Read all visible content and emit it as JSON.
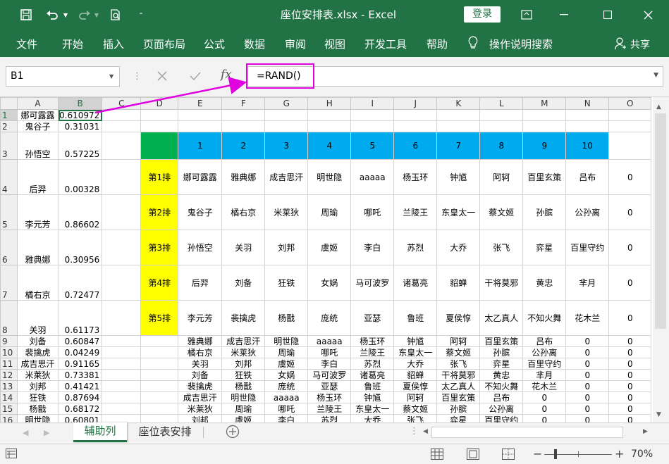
{
  "window": {
    "title": "座位安排表.xlsx  -  Excel",
    "login": "登录"
  },
  "ribbon": {
    "tabs": [
      "文件",
      "开始",
      "插入",
      "页面布局",
      "公式",
      "数据",
      "审阅",
      "视图",
      "开发工具",
      "帮助",
      "操作说明搜索"
    ],
    "share": "共享"
  },
  "formula_bar": {
    "cell": "B1",
    "formula": "=RAND()"
  },
  "columns": [
    "A",
    "B",
    "C",
    "D",
    "E",
    "F",
    "G",
    "H",
    "I",
    "J",
    "K",
    "L",
    "M",
    "N",
    "O"
  ],
  "numbers": [
    "1",
    "2",
    "3",
    "4",
    "5",
    "6",
    "7",
    "8",
    "9",
    "10"
  ],
  "rows": [
    {
      "num": "1",
      "a": "娜可露露",
      "b": "0.610972"
    },
    {
      "num": "2",
      "a": "鬼谷子",
      "b": "0.31031"
    },
    {
      "num": "3",
      "a": "孙悟空",
      "b": "0.57225"
    },
    {
      "num": "4",
      "a": "后羿",
      "b": "0.00328",
      "d": "第1排",
      "e": [
        "娜可露露",
        "雅典娜",
        "成吉思汗",
        "明世隐",
        "aaaaa",
        "杨玉环",
        "钟馗",
        "阿轲",
        "百里玄策",
        "吕布"
      ],
      "o": "0"
    },
    {
      "num": "5",
      "a": "李元芳",
      "b": "0.86602",
      "d": "第2排",
      "e": [
        "鬼谷子",
        "橘右京",
        "米莱狄",
        "周瑜",
        "哪吒",
        "兰陵王",
        "东皇太一",
        "蔡文姬",
        "孙膑",
        "公孙离"
      ],
      "o": "0"
    },
    {
      "num": "6",
      "a": "雅典娜",
      "b": "0.30956",
      "d": "第3排",
      "e": [
        "孙悟空",
        "关羽",
        "刘邦",
        "虞姬",
        "李白",
        "苏烈",
        "大乔",
        "张飞",
        "弈星",
        "百里守约"
      ],
      "o": "0"
    },
    {
      "num": "7",
      "a": "橘右京",
      "b": "0.72477",
      "d": "第4排",
      "e": [
        "后羿",
        "刘备",
        "狂铁",
        "女娲",
        "马可波罗",
        "诸葛亮",
        "貂蝉",
        "干将莫邪",
        "黄忠",
        "芈月"
      ],
      "o": "0"
    },
    {
      "num": "8",
      "a": "关羽",
      "b": "0.61173",
      "d": "第5排",
      "e": [
        "李元芳",
        "裴擒虎",
        "杨戬",
        "庞统",
        "亚瑟",
        "鲁班",
        "夏侯惇",
        "太乙真人",
        "不知火舞",
        "花木兰"
      ],
      "o": "0"
    },
    {
      "num": "9",
      "a": "刘备",
      "b": "0.60847",
      "e": [
        "雅典娜",
        "成吉思汗",
        "明世隐",
        "aaaaa",
        "杨玉环",
        "钟馗",
        "阿轲",
        "百里玄策",
        "吕布",
        "0",
        "0"
      ]
    },
    {
      "num": "10",
      "a": "裴擒虎",
      "b": "0.04249",
      "e": [
        "橘右京",
        "米莱狄",
        "周瑜",
        "哪吒",
        "兰陵王",
        "东皇太一",
        "蔡文姬",
        "孙膑",
        "公孙离",
        "0",
        "0"
      ]
    },
    {
      "num": "11",
      "a": "成吉思汗",
      "b": "0.91165",
      "e": [
        "关羽",
        "刘邦",
        "虞姬",
        "李白",
        "苏烈",
        "大乔",
        "张飞",
        "弈星",
        "百里守约",
        "0",
        "0"
      ]
    },
    {
      "num": "12",
      "a": "米莱狄",
      "b": "0.73381",
      "e": [
        "刘备",
        "狂铁",
        "女娲",
        "马可波罗",
        "诸葛亮",
        "貂蝉",
        "干将莫邪",
        "黄忠",
        "芈月",
        "0",
        "0"
      ]
    },
    {
      "num": "13",
      "a": "刘邦",
      "b": "0.41421",
      "e": [
        "裴擒虎",
        "杨戬",
        "庞统",
        "亚瑟",
        "鲁班",
        "夏侯惇",
        "太乙真人",
        "不知火舞",
        "花木兰",
        "0",
        "0"
      ]
    },
    {
      "num": "14",
      "a": "狂铁",
      "b": "0.87694",
      "e": [
        "成吉思汗",
        "明世隐",
        "aaaaa",
        "杨玉环",
        "钟馗",
        "阿轲",
        "百里玄策",
        "吕布",
        "0",
        "0",
        "0"
      ]
    },
    {
      "num": "15",
      "a": "杨戬",
      "b": "0.68172",
      "e": [
        "米莱狄",
        "周瑜",
        "哪吒",
        "兰陵王",
        "东皇太一",
        "蔡文姬",
        "孙膑",
        "公孙离",
        "0",
        "0",
        "0"
      ]
    },
    {
      "num": "16",
      "a": "明世隐",
      "b": "0.60801",
      "e": [
        "刘邦",
        "虞姬",
        "李白",
        "苏烈",
        "大乔",
        "张飞",
        "弈星",
        "百里守约",
        "0",
        "0",
        "0"
      ]
    }
  ],
  "sheets": [
    "辅助列",
    "座位表安排"
  ],
  "status": {
    "zoom": "70%"
  }
}
